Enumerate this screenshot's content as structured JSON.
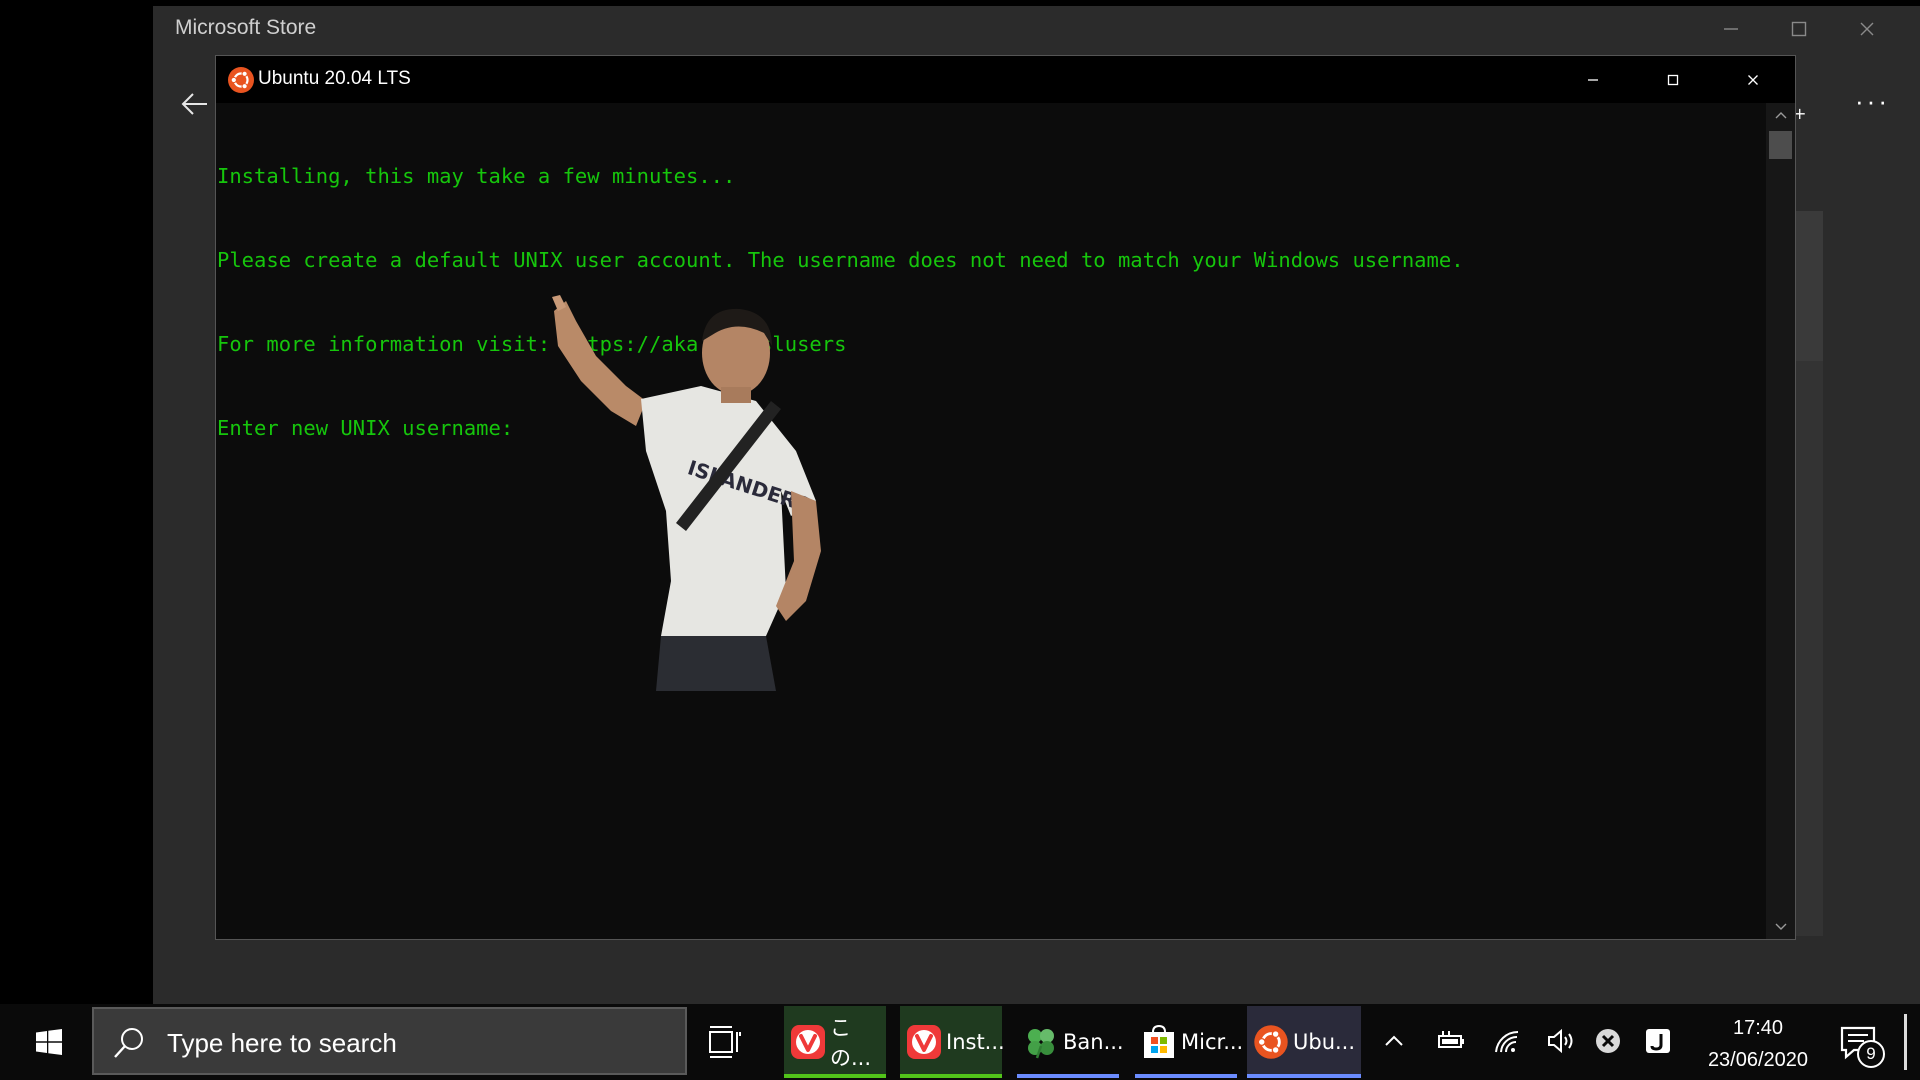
{
  "store": {
    "title": "Microsoft Store",
    "more_label": "···",
    "plus_label": "+"
  },
  "terminal": {
    "title": "Ubuntu 20.04 LTS",
    "lines": [
      "Installing, this may take a few minutes...",
      "Please create a default UNIX user account. The username does not need to match your Windows username.",
      "For more information visit: https://aka.ms/wslusers",
      "Enter new UNIX username:"
    ]
  },
  "taskbar": {
    "search_placeholder": "Type here to search",
    "apps": [
      {
        "label": "この...",
        "icon": "vivaldi-icon",
        "state": "active"
      },
      {
        "label": "Inst...",
        "icon": "vivaldi-icon",
        "state": "active"
      },
      {
        "label": "Ban...",
        "icon": "clover-icon",
        "state": "open"
      },
      {
        "label": "Micr...",
        "icon": "microsoft-store-icon",
        "state": "open"
      },
      {
        "label": "Ubu...",
        "icon": "ubuntu-icon",
        "state": "focused"
      }
    ],
    "time": "17:40",
    "date": "23/06/2020",
    "notification_count": "9"
  },
  "colors": {
    "terminal_text": "#16c60c",
    "ubuntu_orange": "#e95420",
    "vivaldi_red": "#ef3939",
    "active_underline_green": "#52c41a",
    "open_underline_blue": "#6b8cff"
  }
}
